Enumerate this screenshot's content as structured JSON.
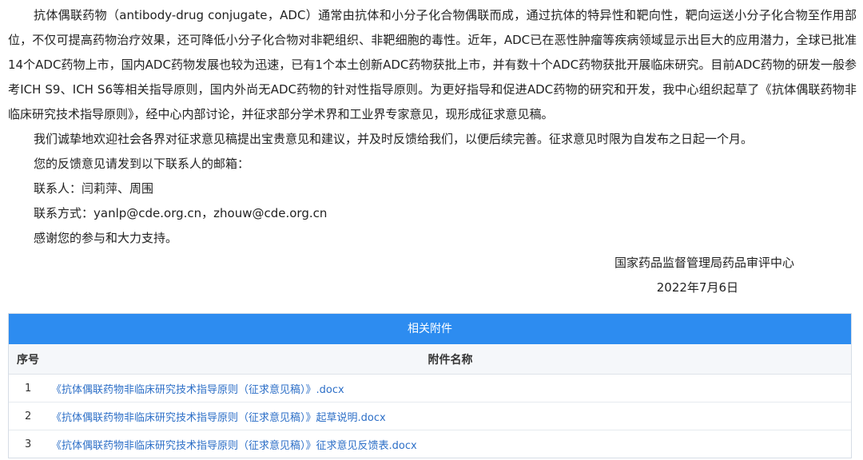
{
  "notice": {
    "paragraph_1": "抗体偶联药物（antibody-drug conjugate，ADC）通常由抗体和小分子化合物偶联而成，通过抗体的特异性和靶向性，靶向运送小分子化合物至作用部位，不仅可提高药物治疗效果，还可降低小分子化合物对非靶组织、非靶细胞的毒性。近年，ADC已在恶性肿瘤等疾病领域显示出巨大的应用潜力，全球已批准14个ADC药物上市，国内ADC药物发展也较为迅速，已有1个本土创新ADC药物获批上市，并有数十个ADC药物获批开展临床研究。目前ADC药物的研发一般参考ICH S9、ICH S6等相关指导原则，国内外尚无ADC药物的针对性指导原则。为更好指导和促进ADC药物的研究和开发，我中心组织起草了《抗体偶联药物非临床研究技术指导原则》，经中心内部讨论，并征求部分学术界和工业界专家意见，现形成征求意见稿。",
    "paragraph_2": "我们诚挚地欢迎社会各界对征求意见稿提出宝贵意见和建议，并及时反馈给我们，以便后续完善。征求意见时限为自发布之日起一个月。",
    "feedback_intro": "您的反馈意见请发到以下联系人的邮箱：",
    "contacts": "联系人：闫莉萍、周围",
    "contact_method": "联系方式：yanlp@cde.org.cn，zhouw@cde.org.cn",
    "thanks": "感谢您的参与和大力支持。",
    "signature_org": "国家药品监督管理局药品审评中心",
    "signature_date": "2022年7月6日"
  },
  "attachments": {
    "title": "相关附件",
    "col_seq": "序号",
    "col_name": "附件名称",
    "rows": [
      {
        "seq": "1",
        "name": "《抗体偶联药物非临床研究技术指导原则（征求意见稿）》.docx"
      },
      {
        "seq": "2",
        "name": "《抗体偶联药物非临床研究技术指导原则（征求意见稿）》起草说明.docx"
      },
      {
        "seq": "3",
        "name": "《抗体偶联药物非临床研究技术指导原则（征求意见稿）》征求意见反馈表.docx"
      }
    ]
  },
  "colors": {
    "header_bg": "#2d8cf0",
    "link": "#2d6fc7",
    "text": "#222222"
  }
}
